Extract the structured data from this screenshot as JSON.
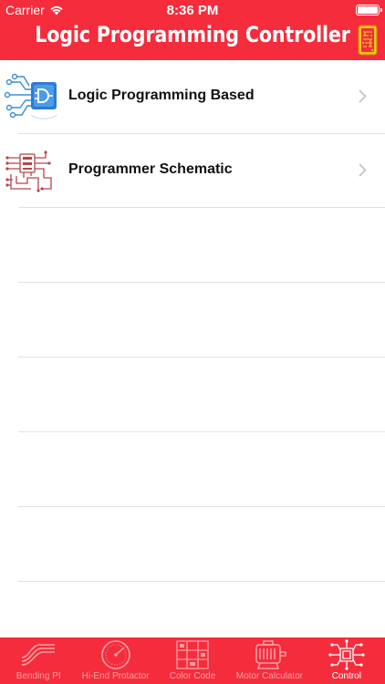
{
  "status_bar": {
    "carrier": "Carrier",
    "time": "8:36 PM"
  },
  "nav": {
    "title": "Logic Programming Controller",
    "right_icon": "circuit-board-icon"
  },
  "list": {
    "items": [
      {
        "label": "Logic Programming Based",
        "icon": "logic-chip-icon"
      },
      {
        "label": "Programmer Schematic",
        "icon": "schematic-board-icon"
      }
    ]
  },
  "tabs": [
    {
      "label": "Bending PI",
      "icon": "bending-wave-icon",
      "active": false
    },
    {
      "label": "Hi-End Protactor",
      "icon": "protractor-gauge-icon",
      "active": false
    },
    {
      "label": "Color Code",
      "icon": "color-code-grid-icon",
      "active": false
    },
    {
      "label": "Motor Calculator",
      "icon": "motor-icon",
      "active": false
    },
    {
      "label": "Control",
      "icon": "circuit-control-icon",
      "active": true
    }
  ],
  "colors": {
    "brand_red": "#f52c3c",
    "tab_inactive": "#f9a0a7",
    "separator": "#e2e2e4"
  }
}
